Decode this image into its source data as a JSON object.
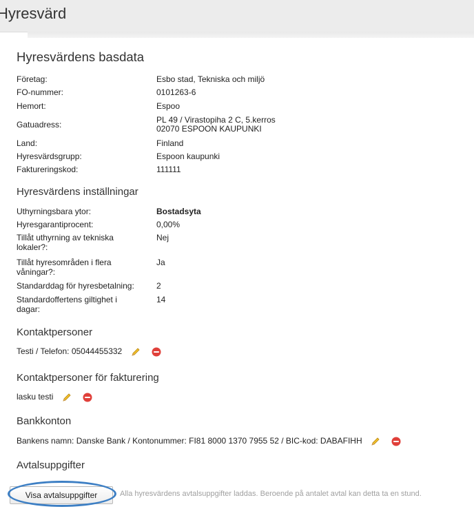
{
  "header": {
    "title": "Hyresvärd"
  },
  "basdata": {
    "heading": "Hyresvärdens basdata",
    "rows": [
      {
        "label": "Företag:",
        "value": "Esbo stad, Tekniska och miljö"
      },
      {
        "label": "FO-nummer:",
        "value": "0101263-6"
      },
      {
        "label": "Hemort:",
        "value": "Espoo"
      },
      {
        "label": "Gatuadress:",
        "value_line1": "PL 49 / Virastopiha 2 C, 5.kerros",
        "value_line2": "02070 ESPOON KAUPUNKI"
      },
      {
        "label": "Land:",
        "value": "Finland"
      },
      {
        "label": "Hyresvärdsgrupp:",
        "value": "Espoon kaupunki"
      },
      {
        "label": "Faktureringskod:",
        "value": "111111"
      }
    ]
  },
  "settings": {
    "heading": "Hyresvärdens inställningar",
    "rows": [
      {
        "label": "Uthyrningsbara ytor:",
        "value": "Bostadsyta"
      },
      {
        "label": "Hyresgarantiprocent:",
        "value": "0,00%"
      },
      {
        "label_line1": "Tillåt uthyrning av tekniska",
        "label_line2": "lokaler?:",
        "value": "Nej"
      },
      {
        "label_line1": "Tillåt hyresområden i flera",
        "label_line2": "våningar?:",
        "value": "Ja"
      },
      {
        "label": "Standarddag för hyresbetalning:",
        "value": "2"
      },
      {
        "label_line1": "Standardoffertens giltighet i",
        "label_line2": "dagar:",
        "value": "14"
      }
    ]
  },
  "contacts": {
    "heading": "Kontaktpersoner",
    "item": "Testi / Telefon: 05044455332"
  },
  "billing_contacts": {
    "heading": "Kontaktpersoner för fakturering",
    "item": "lasku testi"
  },
  "bank": {
    "heading": "Bankkonton",
    "item": "Bankens namn: Danske Bank / Kontonummer: FI81 8000 1370 7955 52 / BIC-kod: DABAFIHH"
  },
  "agreement": {
    "heading": "Avtalsuppgifter",
    "button_label": "Visa avtalsuppgifter",
    "hint": "Alla hyresvärdens avtalsuppgifter laddas. Beroende på antalet avtal kan detta ta en stund."
  },
  "icons": {
    "edit": "pencil-icon",
    "remove": "remove-circle-icon"
  },
  "colors": {
    "link": "#1a7fbf",
    "remove": "#e0403a",
    "highlight": "#3d7fc4"
  }
}
